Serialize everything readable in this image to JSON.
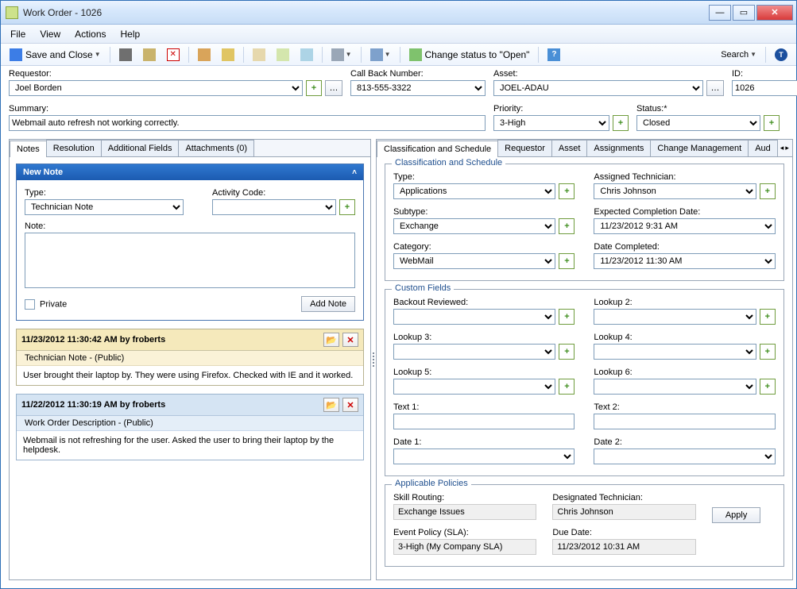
{
  "window": {
    "title": "Work Order - 1026"
  },
  "menu": {
    "file": "File",
    "view": "View",
    "actions": "Actions",
    "help": "Help"
  },
  "toolbar": {
    "save_close": "Save and Close",
    "change_status": "Change status to \"Open\"",
    "search": "Search"
  },
  "top": {
    "requestor_label": "Requestor:",
    "requestor_value": "Joel Borden",
    "callback_label": "Call Back Number:",
    "callback_value": "813-555-3322",
    "asset_label": "Asset:",
    "asset_value": "JOEL-ADAU",
    "id_label": "ID:",
    "id_value": "1026",
    "summary_label": "Summary:",
    "summary_value": "Webmail auto refresh not working correctly.",
    "priority_label": "Priority:",
    "priority_value": "3-High",
    "status_label": "Status:*",
    "status_value": "Closed"
  },
  "left_tabs": {
    "notes": "Notes",
    "resolution": "Resolution",
    "additional": "Additional Fields",
    "attachments": "Attachments (0)"
  },
  "right_tabs": {
    "class": "Classification and Schedule",
    "requestor": "Requestor",
    "asset": "Asset",
    "assignments": "Assignments",
    "change": "Change Management",
    "audit": "Aud"
  },
  "newnote": {
    "header": "New Note",
    "type_label": "Type:",
    "type_value": "Technician Note",
    "activity_label": "Activity Code:",
    "activity_value": "",
    "note_label": "Note:",
    "note_value": "",
    "private": "Private",
    "addnote": "Add Note"
  },
  "notes": [
    {
      "header": "11/23/2012 11:30:42 AM by froberts",
      "sub": "Technician Note -  (Public)",
      "text": "User brought their laptop by. They were using Firefox. Checked with IE and it worked.",
      "style": "yellow"
    },
    {
      "header": "11/22/2012 11:30:19 AM by froberts",
      "sub": "Work Order Description -  (Public)",
      "text": "Webmail is not refreshing for the user. Asked the user to bring their laptop by the helpdesk.",
      "style": "blue"
    }
  ],
  "class_sched": {
    "legend": "Classification and Schedule",
    "type_label": "Type:",
    "type_value": "Applications",
    "subtype_label": "Subtype:",
    "subtype_value": "Exchange",
    "category_label": "Category:",
    "category_value": "WebMail",
    "tech_label": "Assigned Technician:",
    "tech_value": "Chris Johnson",
    "expected_label": "Expected Completion Date:",
    "expected_value": "11/23/2012 9:31 AM",
    "completed_label": "Date Completed:",
    "completed_value": "11/23/2012 11:30 AM"
  },
  "custom": {
    "legend": "Custom Fields",
    "backout": "Backout Reviewed:",
    "l2": "Lookup 2:",
    "l3": "Lookup 3:",
    "l4": "Lookup 4:",
    "l5": "Lookup 5:",
    "l6": "Lookup 6:",
    "t1": "Text 1:",
    "t2": "Text 2:",
    "d1": "Date 1:",
    "d2": "Date 2:"
  },
  "policies": {
    "legend": "Applicable Policies",
    "skill_label": "Skill Routing:",
    "skill_value": "Exchange Issues",
    "desig_label": "Designated Technician:",
    "desig_value": "Chris Johnson",
    "event_label": "Event Policy (SLA):",
    "event_value": "3-High (My Company SLA)",
    "due_label": "Due Date:",
    "due_value": "11/23/2012 10:31 AM",
    "apply": "Apply"
  }
}
